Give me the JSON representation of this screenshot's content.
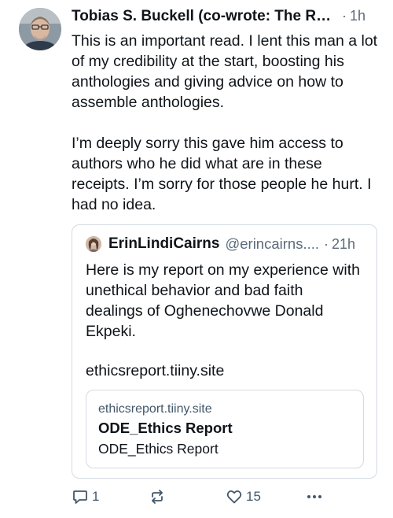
{
  "post": {
    "author": "Tobias S. Buckell (co-wrote: The Ru...",
    "separator": "·",
    "time": "1h",
    "paragraphs": [
      "This is an important read. I lent this man a lot of my credibility at the start, boosting his anthologies and giving advice on how to assemble anthologies.",
      "I’m deeply sorry this gave him access to authors who he did what are in these receipts. I’m sorry for those people he hurt. I had no idea."
    ]
  },
  "quote": {
    "name": "ErinLindiCairns",
    "handle": "@erincairns....",
    "separator": "·",
    "time": "21h",
    "paragraphs": [
      "Here is my report on my experience with unethical behavior and bad faith dealings of Oghenechovwe Donald Ekpeki.",
      "ethicsreport.tiiny.site"
    ],
    "link_card": {
      "domain": "ethicsreport.tiiny.site",
      "title": "ODE_Ethics Report",
      "description": "ODE_Ethics Report"
    }
  },
  "actions": {
    "replies": "1",
    "reposts": "",
    "likes": "15"
  },
  "icons": {
    "reply": "reply-icon",
    "repost": "repost-icon",
    "like": "heart-icon",
    "more": "more-icon"
  },
  "colors": {
    "text": "#0f1419",
    "muted": "#5b6b7b",
    "action": "#42576b",
    "border": "#d4dbe2"
  }
}
